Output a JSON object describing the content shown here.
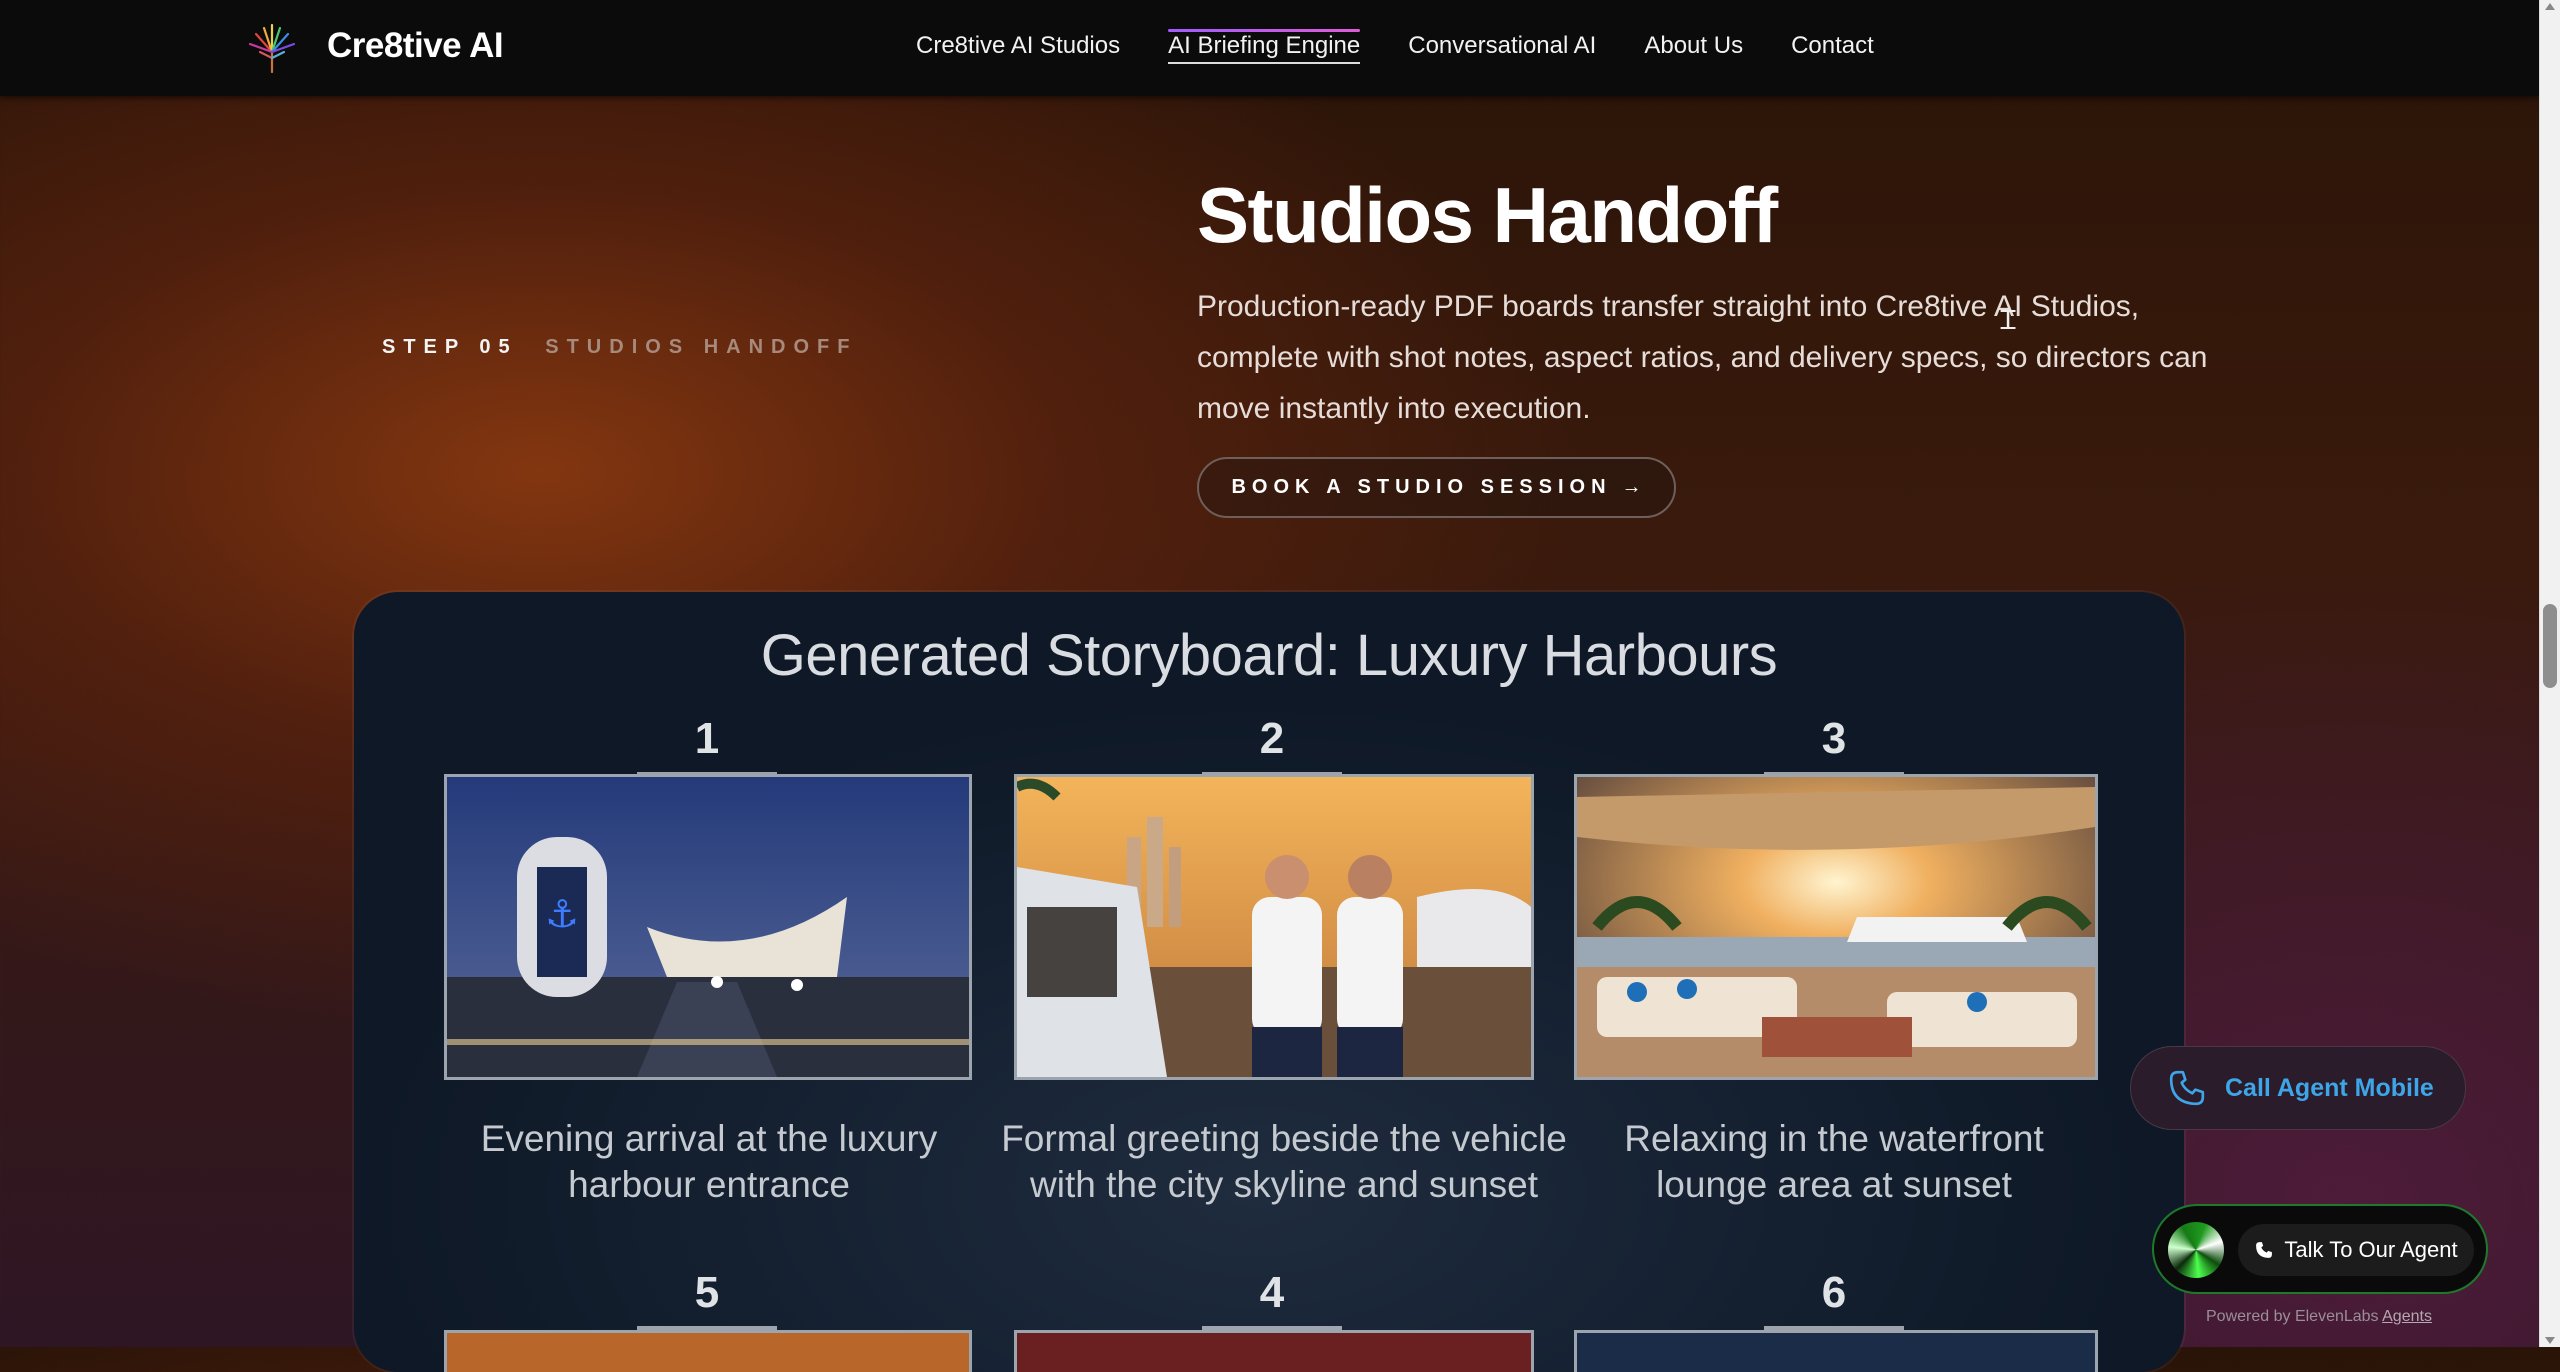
{
  "nav": {
    "brand": "Cre8tive AI",
    "links": [
      {
        "label": "Cre8tive AI Studios"
      },
      {
        "label": "AI Briefing Engine",
        "active": true
      },
      {
        "label": "Conversational AI"
      },
      {
        "label": "About Us"
      },
      {
        "label": "Contact"
      }
    ]
  },
  "hero": {
    "step_number": "STEP 05",
    "step_name": "STUDIOS HANDOFF",
    "title": "Studios Handoff",
    "body": "Production-ready PDF boards transfer straight into Cre8tive AI Studios, complete with shot notes, aspect ratios, and delivery specs, so directors can move instantly into execution.",
    "cta_label": "BOOK A STUDIO SESSION",
    "cta_arrow": "→"
  },
  "storyboard": {
    "title": "Generated Storyboard: Luxury Harbours",
    "panels": [
      {
        "number": "1",
        "caption": "Evening arrival at the luxury harbour entrance"
      },
      {
        "number": "2",
        "caption": "Formal greeting beside the vehicle with the city skyline and sunset"
      },
      {
        "number": "3",
        "caption": "Relaxing in the waterfront lounge area at sunset"
      },
      {
        "number": "5",
        "caption": ""
      },
      {
        "number": "4",
        "caption": ""
      },
      {
        "number": "6",
        "caption": ""
      }
    ]
  },
  "widgets": {
    "call_mobile_label": "Call Agent Mobile",
    "talk_label": "Talk To Our Agent",
    "powered_prefix": "Powered by ElevenLabs",
    "powered_link": "Agents"
  },
  "colors": {
    "nav_bg": "#0b0b0b",
    "accent_blue": "#3da5e8",
    "agent_green": "#1d7a2c",
    "active_underline": "#a05cff"
  }
}
